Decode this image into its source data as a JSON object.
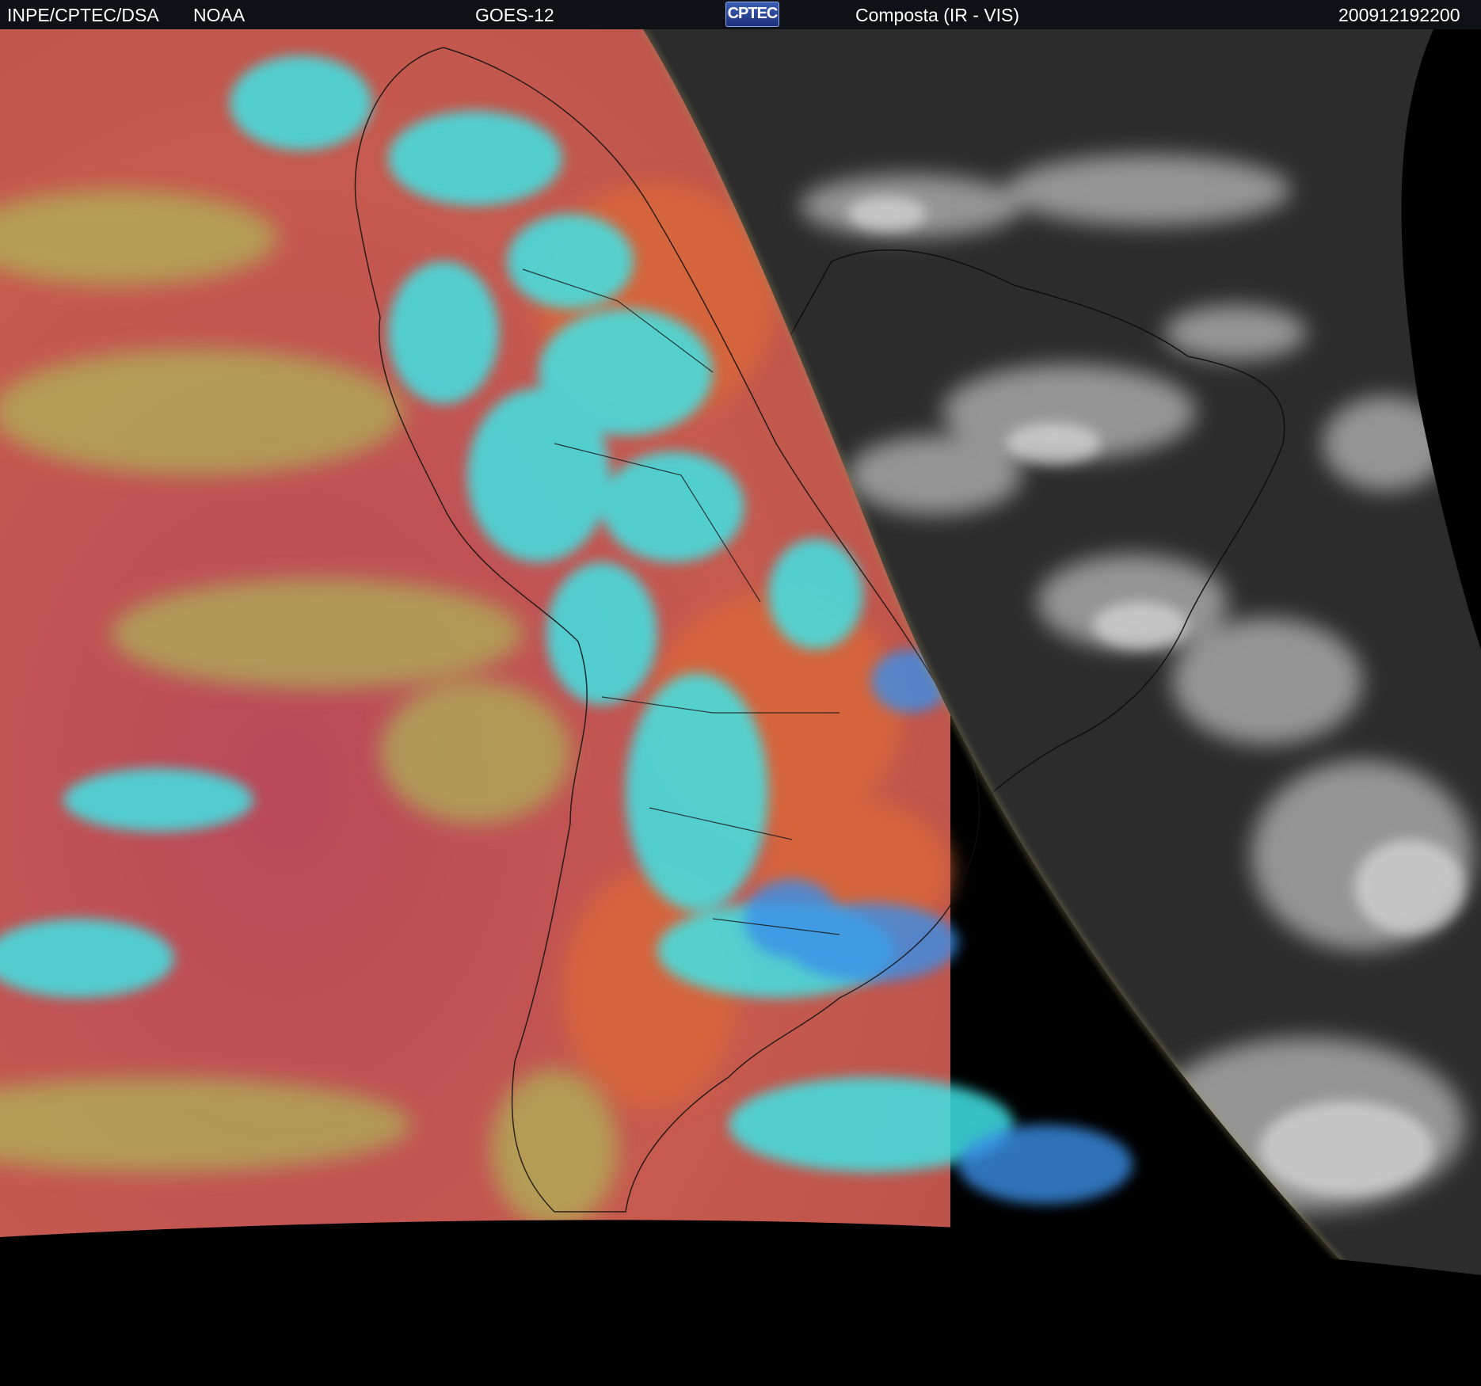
{
  "header": {
    "agency": "INPE/CPTEC/DSA",
    "partner": "NOAA",
    "satellite": "GOES-12",
    "logo_text": "CPTEC",
    "product": "Composta (IR - VIS)",
    "timestamp": "200912192200"
  },
  "colors": {
    "header_bg": "#0e1116",
    "ir_surface": "#c65a4e",
    "ir_land_orange": "#d8673a",
    "ir_cold_cyan": "#3fe3e6",
    "ir_mid_green": "#a8d65a",
    "ir_cold_blue": "#3a8fe8",
    "vis_background": "#2a2a2a",
    "vis_clouds": "#c8c8c8",
    "space": "#000000"
  }
}
